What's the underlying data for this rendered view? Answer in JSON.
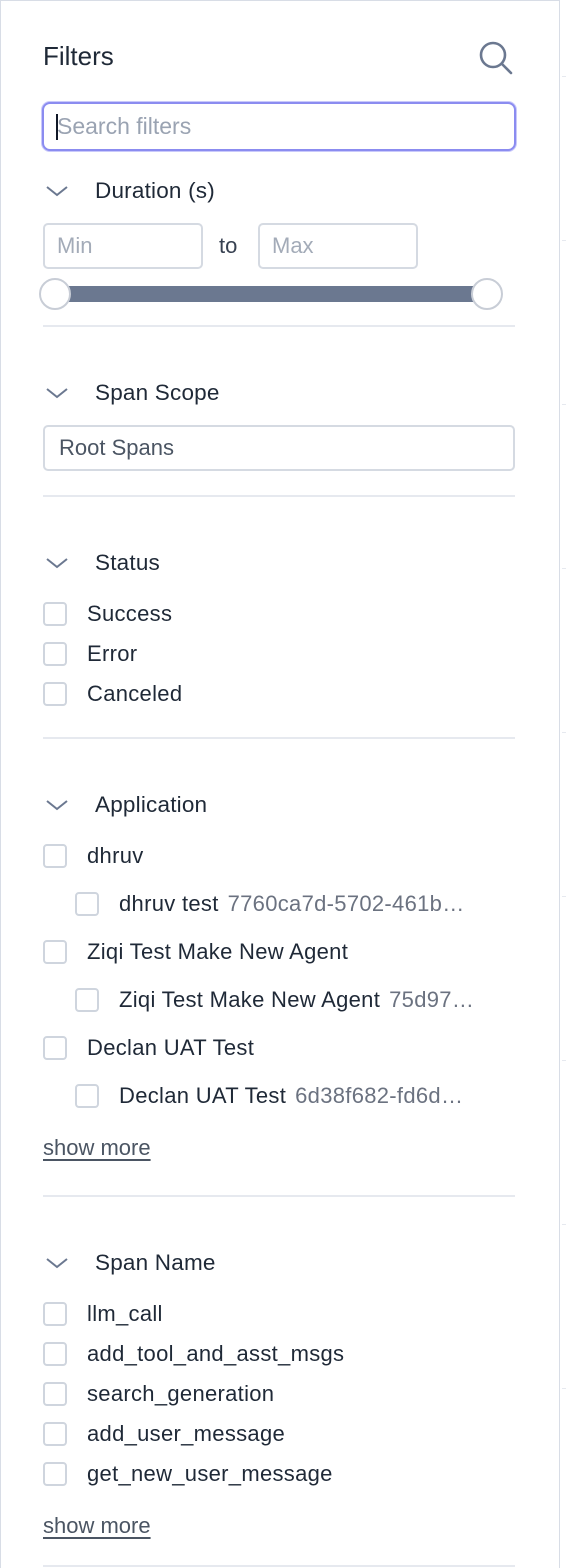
{
  "header": {
    "title": "Filters",
    "search_icon": "search-icon"
  },
  "search": {
    "placeholder": "Search filters"
  },
  "duration": {
    "title": "Duration (s)",
    "min_placeholder": "Min",
    "to_label": "to",
    "max_placeholder": "Max"
  },
  "span_scope": {
    "title": "Span Scope",
    "selected": "Root Spans"
  },
  "status": {
    "title": "Status",
    "items": [
      "Success",
      "Error",
      "Canceled"
    ]
  },
  "application": {
    "title": "Application",
    "items": [
      {
        "label": "dhruv"
      },
      {
        "label": "dhruv test",
        "id": "7760ca7d-5702-461b…"
      },
      {
        "label": "Ziqi Test Make New Agent"
      },
      {
        "label": "Ziqi Test Make New Agent",
        "id": "75d97…"
      },
      {
        "label": "Declan UAT Test"
      },
      {
        "label": "Declan UAT Test",
        "id": "6d38f682-fd6d…"
      }
    ],
    "show_more": "show more"
  },
  "span_name": {
    "title": "Span Name",
    "items": [
      "llm_call",
      "add_tool_and_asst_msgs",
      "search_generation",
      "add_user_message",
      "get_new_user_message"
    ],
    "show_more": "show more"
  },
  "colors": {
    "accent": "#8b8cf0",
    "slider": "#6b7890",
    "border": "#d5dae2"
  }
}
